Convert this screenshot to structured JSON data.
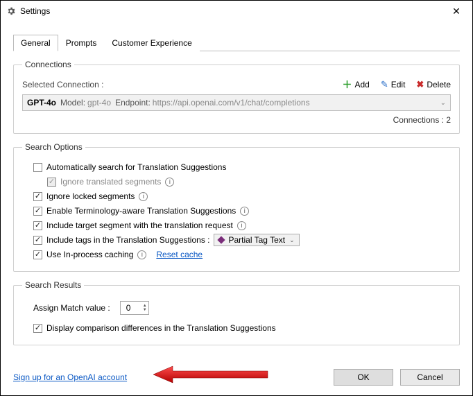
{
  "titlebar": {
    "title": "Settings"
  },
  "tabs": {
    "general": "General",
    "prompts": "Prompts",
    "cx": "Customer Experience"
  },
  "connections": {
    "legend": "Connections",
    "label": "Selected Connection :",
    "add": "Add",
    "edit": "Edit",
    "delete": "Delete",
    "selected": {
      "name": "GPT-4o",
      "model_label": "Model:",
      "model_value": "gpt-4o",
      "endpoint_label": "Endpoint:",
      "endpoint_value": "https://api.openai.com/v1/chat/completions"
    },
    "count_label": "Connections : 2"
  },
  "searchOptions": {
    "legend": "Search Options",
    "autoSearch": "Automatically search for Translation Suggestions",
    "ignoreTranslated": "Ignore translated segments",
    "ignoreLocked": "Ignore locked segments",
    "terminology": "Enable Terminology-aware Translation Suggestions",
    "includeTarget": "Include target segment with the translation request",
    "includeTagsLabel": "Include tags in the Translation Suggestions :",
    "tagMode": "Partial Tag Text",
    "useCache": "Use In-process caching",
    "resetCache": "Reset cache"
  },
  "searchResults": {
    "legend": "Search Results",
    "assignLabel": "Assign Match value :",
    "assignValue": "0",
    "displayDiff": "Display comparison differences in the Translation Suggestions"
  },
  "footer": {
    "signup": "Sign up for an OpenAI account",
    "ok": "OK",
    "cancel": "Cancel"
  }
}
